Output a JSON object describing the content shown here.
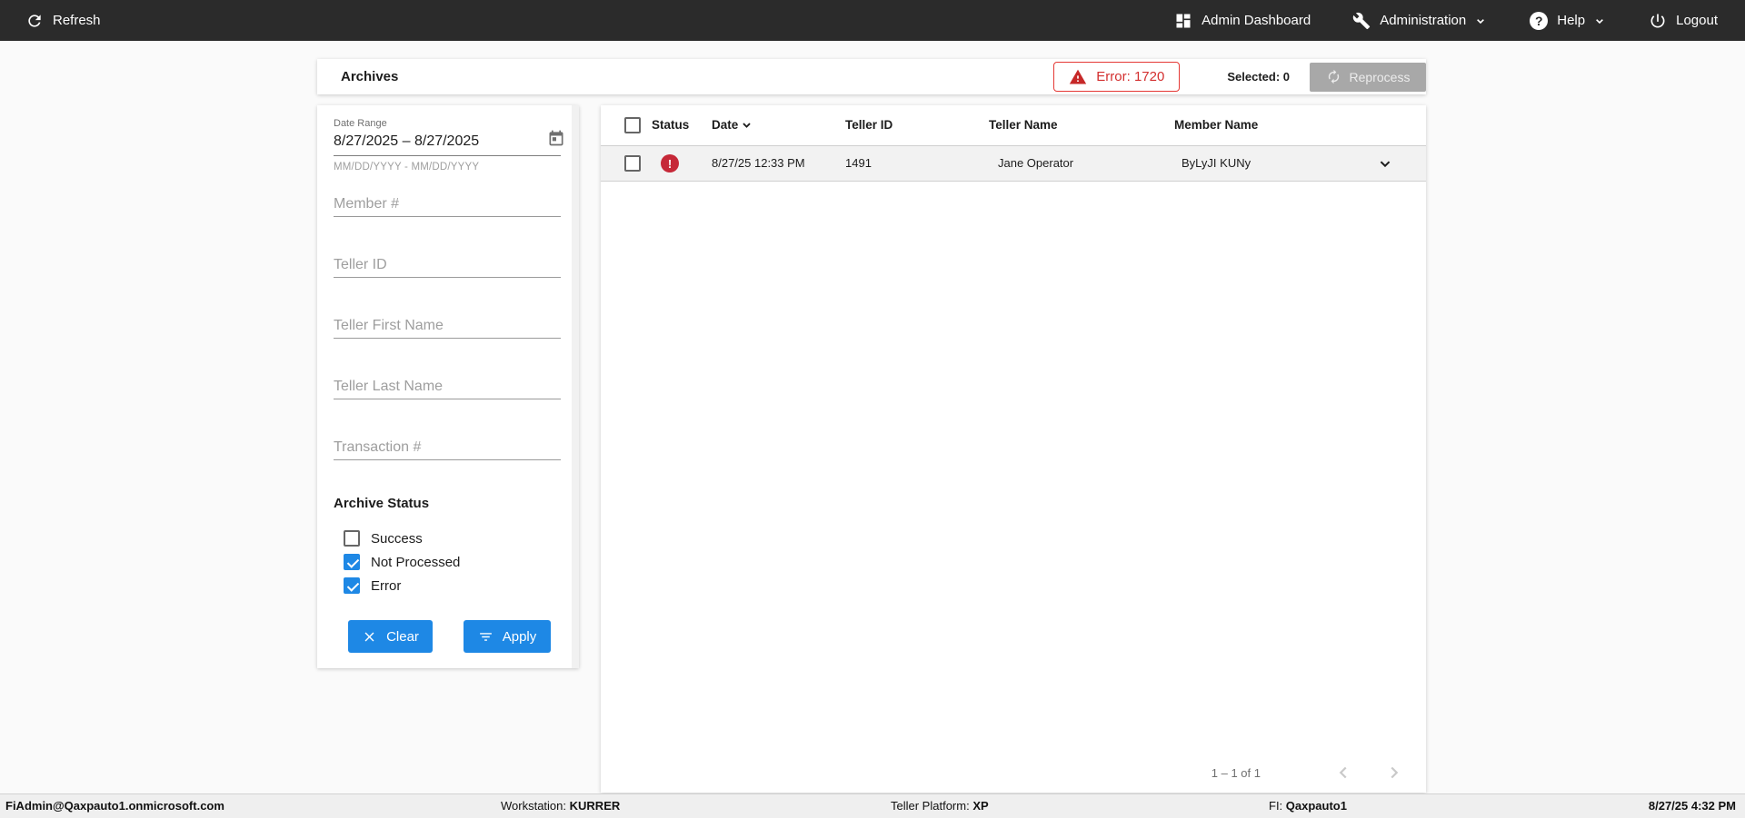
{
  "topbar": {
    "refresh_label": "Refresh",
    "admin_dashboard_label": "Admin Dashboard",
    "administration_label": "Administration",
    "help_label": "Help",
    "logout_label": "Logout"
  },
  "header": {
    "title": "Archives",
    "error_badge_label": "Error: 1720",
    "selected_label": "Selected: 0",
    "reprocess_label": "Reprocess"
  },
  "filters": {
    "date_range": {
      "label": "Date Range",
      "value": "8/27/2025 – 8/27/2025",
      "hint": "MM/DD/YYYY - MM/DD/YYYY"
    },
    "fields": [
      {
        "placeholder": "Member #"
      },
      {
        "placeholder": "Teller ID"
      },
      {
        "placeholder": "Teller First Name"
      },
      {
        "placeholder": "Teller Last Name"
      },
      {
        "placeholder": "Transaction #"
      }
    ],
    "archive_status": {
      "label": "Archive Status",
      "options": [
        {
          "label": "Success",
          "checked": false
        },
        {
          "label": "Not Processed",
          "checked": true
        },
        {
          "label": "Error",
          "checked": true
        }
      ]
    },
    "buttons": {
      "clear": "Clear",
      "apply": "Apply"
    }
  },
  "table": {
    "columns": [
      "Status",
      "Date",
      "Teller ID",
      "Teller Name",
      "Member Name"
    ],
    "sort_column": "Date",
    "rows": [
      {
        "status": "error",
        "date": "8/27/25 12:33 PM",
        "teller_id": "1491",
        "teller_name": "Jane Operator",
        "member_name": "ByLyJI KUNy"
      }
    ],
    "pagination": {
      "range_label": "1 – 1 of 1"
    }
  },
  "statusbar": {
    "user": "FiAdmin@Qaxpauto1.onmicrosoft.com",
    "workstation_label": "Workstation:",
    "workstation_value": "KURRER",
    "platform_label": "Teller Platform:",
    "platform_value": "XP",
    "fi_label": "FI:",
    "fi_value": "Qaxpauto1",
    "datetime": "8/27/25 4:32 PM"
  },
  "icons": {
    "refresh-icon": "circular arrow",
    "dashboard-icon": "four tiles grid",
    "wrench-icon": "wrench",
    "help-icon": "question mark in circle",
    "power-icon": "power symbol",
    "warning-icon": "red triangle with exclamation",
    "reprocess-icon": "two circular arrows",
    "calendar-icon": "calendar with small square",
    "clear-icon": "X cross",
    "filter-icon": "filter lines",
    "sort-desc-icon": "chevron down",
    "expand-icon": "chevron down",
    "error-status-icon": "red circle with exclamation"
  },
  "colors": {
    "topbar_bg": "#2b2b2b",
    "accent_blue": "#1e88e5",
    "error_red": "#d32f2f",
    "error_icon_red": "#c62838",
    "disabled_gray": "#a8a8a8",
    "row_bg": "#f2f2f2",
    "page_bg": "#fafafa"
  }
}
